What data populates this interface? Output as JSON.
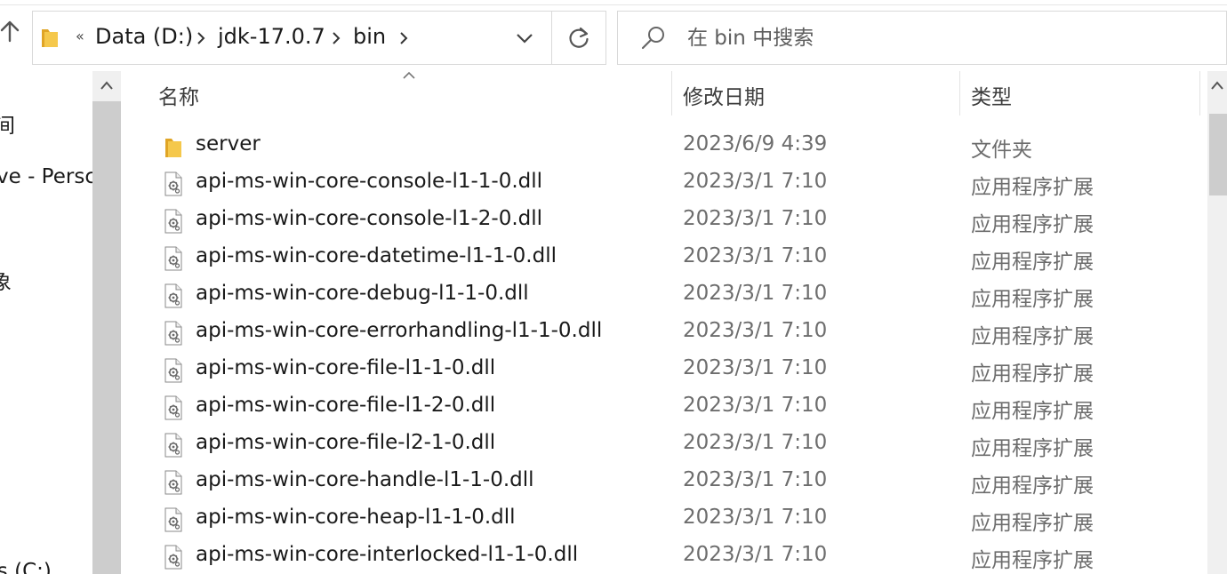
{
  "address": {
    "overflow": "«",
    "crumbs": [
      "Data (D:)",
      "jdk-17.0.7",
      "bin"
    ]
  },
  "search": {
    "placeholder": "在 bin 中搜索"
  },
  "nav": {
    "items": [
      "间",
      "ve - Persc",
      "象",
      "ws (C:)"
    ]
  },
  "columns": {
    "name": "名称",
    "date": "修改日期",
    "type": "类型"
  },
  "files": [
    {
      "name": "server",
      "date": "2023/6/9 4:39",
      "type": "文件夹",
      "icon": "folder-icon"
    },
    {
      "name": "api-ms-win-core-console-l1-1-0.dll",
      "date": "2023/3/1 7:10",
      "type": "应用程序扩展",
      "icon": "dll-file-icon"
    },
    {
      "name": "api-ms-win-core-console-l1-2-0.dll",
      "date": "2023/3/1 7:10",
      "type": "应用程序扩展",
      "icon": "dll-file-icon"
    },
    {
      "name": "api-ms-win-core-datetime-l1-1-0.dll",
      "date": "2023/3/1 7:10",
      "type": "应用程序扩展",
      "icon": "dll-file-icon"
    },
    {
      "name": "api-ms-win-core-debug-l1-1-0.dll",
      "date": "2023/3/1 7:10",
      "type": "应用程序扩展",
      "icon": "dll-file-icon"
    },
    {
      "name": "api-ms-win-core-errorhandling-l1-1-0.dll",
      "date": "2023/3/1 7:10",
      "type": "应用程序扩展",
      "icon": "dll-file-icon"
    },
    {
      "name": "api-ms-win-core-file-l1-1-0.dll",
      "date": "2023/3/1 7:10",
      "type": "应用程序扩展",
      "icon": "dll-file-icon"
    },
    {
      "name": "api-ms-win-core-file-l1-2-0.dll",
      "date": "2023/3/1 7:10",
      "type": "应用程序扩展",
      "icon": "dll-file-icon"
    },
    {
      "name": "api-ms-win-core-file-l2-1-0.dll",
      "date": "2023/3/1 7:10",
      "type": "应用程序扩展",
      "icon": "dll-file-icon"
    },
    {
      "name": "api-ms-win-core-handle-l1-1-0.dll",
      "date": "2023/3/1 7:10",
      "type": "应用程序扩展",
      "icon": "dll-file-icon"
    },
    {
      "name": "api-ms-win-core-heap-l1-1-0.dll",
      "date": "2023/3/1 7:10",
      "type": "应用程序扩展",
      "icon": "dll-file-icon"
    },
    {
      "name": "api-ms-win-core-interlocked-l1-1-0.dll",
      "date": "2023/3/1 7:10",
      "type": "应用程序扩展",
      "icon": "dll-file-icon"
    }
  ],
  "colors": {
    "folder": "#f5c84c",
    "folder_dark": "#e0a526",
    "text_muted": "#6d6d6d",
    "border": "#d9d9d9",
    "scroll_thumb": "#cdcdcd"
  }
}
